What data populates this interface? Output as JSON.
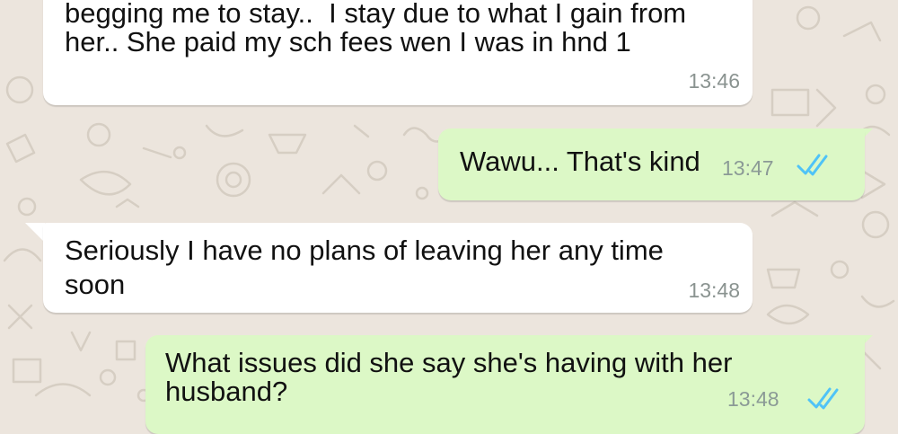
{
  "colors": {
    "incoming_bubble": "#ffffff",
    "outgoing_bubble": "#dcf8c6",
    "wallpaper": "#ece5dd",
    "read_ticks": "#4fc3f7",
    "timestamp": "#8a9390"
  },
  "messages": [
    {
      "direction": "incoming",
      "lines": [
        "begging me to stay..  I stay due to what I gain from",
        "her.. She paid my sch fees wen I was in hnd 1"
      ],
      "time": "13:46"
    },
    {
      "direction": "outgoing",
      "lines": [
        "Wawu... That's kind"
      ],
      "time": "13:47",
      "status_icon": "double-check-read-icon"
    },
    {
      "direction": "incoming",
      "lines": [
        "Seriously I have no plans of leaving her any time",
        "soon"
      ],
      "time": "13:48"
    },
    {
      "direction": "outgoing",
      "lines": [
        "What issues did she say she's having with her",
        "husband?"
      ],
      "time": "13:48",
      "status_icon": "double-check-read-icon"
    }
  ]
}
